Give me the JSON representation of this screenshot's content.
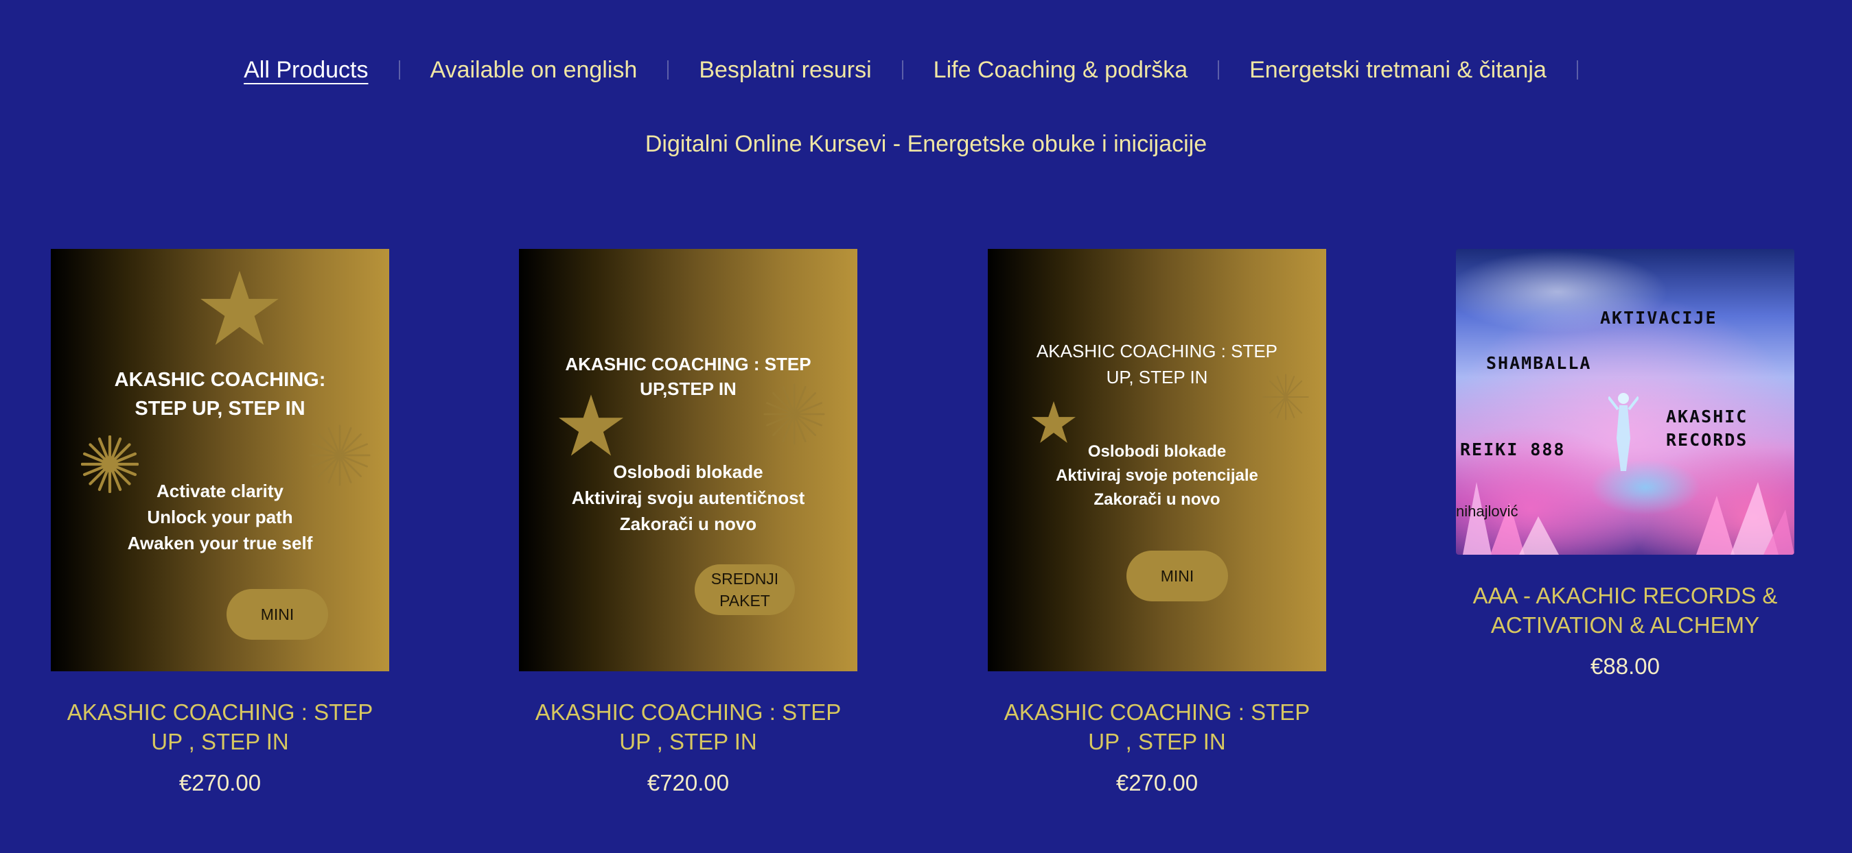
{
  "nav": {
    "categories": [
      {
        "label": "All Products",
        "active": true
      },
      {
        "label": "Available on english",
        "active": false
      },
      {
        "label": "Besplatni resursi",
        "active": false
      },
      {
        "label": "Life Coaching & podrška",
        "active": false
      },
      {
        "label": "Energetski tretmani & čitanja",
        "active": false
      }
    ],
    "second_row": "Digitalni Online Kursevi - Energetske obuke i inicijacije"
  },
  "products": [
    {
      "title": "AKASHIC COACHING : STEP UP , STEP IN",
      "price": "€270.00",
      "image": {
        "heading_line1": "AKASHIC COACHING:",
        "heading_line2": "STEP UP, STEP IN",
        "line1": "Activate clarity",
        "line2": "Unlock your path",
        "line3": "Awaken your true self",
        "pill": "MINI"
      }
    },
    {
      "title": "AKASHIC COACHING : STEP UP , STEP IN",
      "price": "€720.00",
      "image": {
        "heading_line1": "AKASHIC COACHING : STEP",
        "heading_line2": "UP,STEP IN",
        "line1": "Oslobodi blokade",
        "line2": "Aktiviraj svoju autentičnost",
        "line3": "Zakorači u novo",
        "pill_line1": "SREDNJI",
        "pill_line2": "PAKET"
      }
    },
    {
      "title": "AKASHIC COACHING : STEP UP , STEP IN",
      "price": "€270.00",
      "image": {
        "heading_line1": "AKASHIC COACHING : STEP",
        "heading_line2": "UP, STEP IN",
        "line1": "Oslobodi blokade",
        "line2": "Aktiviraj svoje potencijale",
        "line3": "Zakorači u novo",
        "pill": "MINI"
      }
    },
    {
      "title": "AAA - AKACHIC RECORDS & ACTIVATION & ALCHEMY",
      "price": "€88.00",
      "image": {
        "word1": "AKTIVACIJE",
        "word2": "SHAMBALLA",
        "word3_line1": "AKASHIC",
        "word3_line2": "RECORDS",
        "word4": "REIKI 888",
        "credit": "nihajlović"
      }
    }
  ],
  "colors": {
    "page_background": "#1c208a",
    "nav_text": "#f0e6a3",
    "product_title": "#d8c860",
    "price": "#f4ecc4",
    "gold": "#b8933a"
  },
  "icons": [
    "star-icon",
    "sparkle-icon"
  ]
}
